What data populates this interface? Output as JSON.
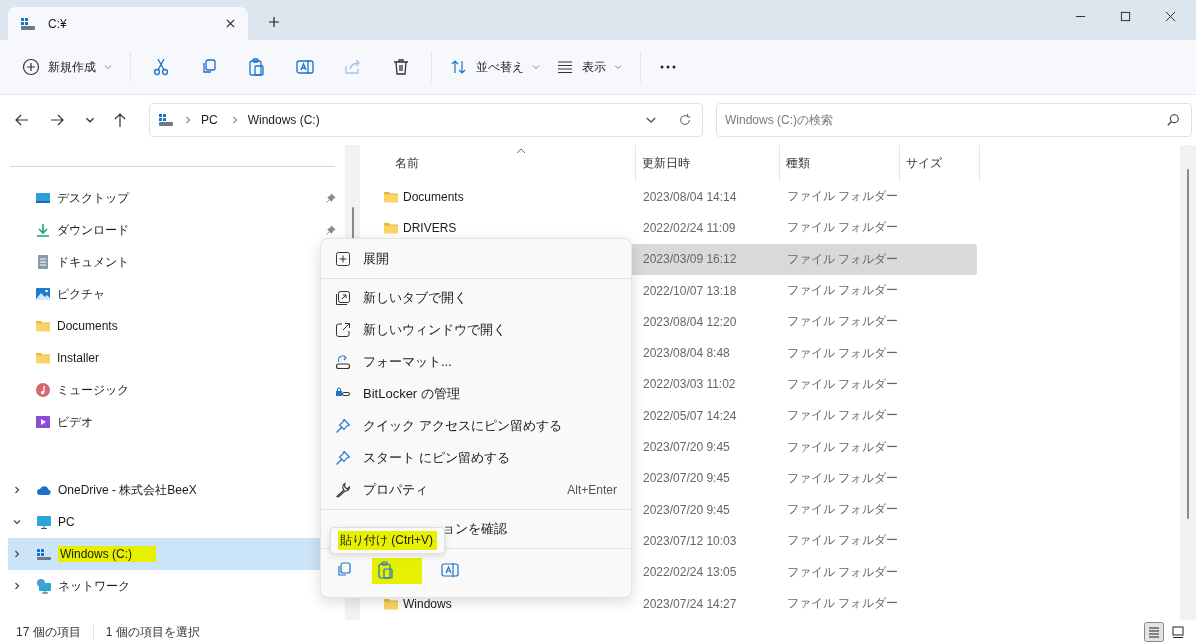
{
  "window": {
    "title": "C:¥"
  },
  "toolbar": {
    "new_label": "新規作成",
    "actions": [
      {
        "kind": "cut",
        "disabled": false
      },
      {
        "kind": "copy",
        "disabled": false
      },
      {
        "kind": "paste",
        "disabled": false
      },
      {
        "kind": "rename",
        "disabled": false
      },
      {
        "kind": "share",
        "disabled": true
      },
      {
        "kind": "delete",
        "disabled": false
      }
    ],
    "sort_label": "並べ替え",
    "view_label": "表示"
  },
  "address": {
    "crumbs": [
      "PC",
      "Windows (C:)"
    ]
  },
  "search": {
    "placeholder": "Windows (C:)の検索"
  },
  "sidebar": {
    "quick_access": [
      {
        "label": "デスクトップ",
        "kind": "desktop",
        "pinned": true
      },
      {
        "label": "ダウンロード",
        "kind": "download",
        "pinned": true
      },
      {
        "label": "ドキュメント",
        "kind": "document"
      },
      {
        "label": "ピクチャ",
        "kind": "picture"
      },
      {
        "label": "Documents",
        "kind": "folder"
      },
      {
        "label": "Installer",
        "kind": "folder"
      },
      {
        "label": "ミュージック",
        "kind": "music"
      },
      {
        "label": "ビデオ",
        "kind": "video"
      }
    ],
    "tree": [
      {
        "label": "OneDrive - 株式会社BeeX",
        "kind": "cloud",
        "expanded": false,
        "selected": false
      },
      {
        "label": "PC",
        "kind": "pc",
        "expanded": true,
        "selected": false,
        "children": [
          {
            "label": "Windows (C:)",
            "kind": "drive",
            "expanded": false,
            "selected": true,
            "highlighted": true
          }
        ]
      },
      {
        "label": "ネットワーク",
        "kind": "network",
        "expanded": false,
        "selected": false
      }
    ]
  },
  "file_list": {
    "columns": [
      "名前",
      "更新日時",
      "種類",
      "サイズ"
    ],
    "rows": [
      {
        "name": "Documents",
        "modified": "2023/08/04 14:14",
        "type": "ファイル フォルダー",
        "selected": false
      },
      {
        "name": "DRIVERS",
        "modified": "2022/02/24 11:09",
        "type": "ファイル フォルダー",
        "selected": false
      },
      {
        "modified": "2023/03/09 16:12",
        "type": "ファイル フォルダー",
        "selected": true
      },
      {
        "modified": "2022/10/07 13:18",
        "type": "ファイル フォルダー",
        "selected": false
      },
      {
        "modified": "2023/08/04 12:20",
        "type": "ファイル フォルダー",
        "selected": false
      },
      {
        "modified": "2023/08/04 8:48",
        "type": "ファイル フォルダー",
        "selected": false
      },
      {
        "modified": "2022/03/03 11:02",
        "type": "ファイル フォルダー",
        "selected": false
      },
      {
        "modified": "2022/05/07 14:24",
        "type": "ファイル フォルダー",
        "selected": false
      },
      {
        "modified": "2023/07/20 9:45",
        "type": "ファイル フォルダー",
        "selected": false
      },
      {
        "modified": "2023/07/20 9:45",
        "type": "ファイル フォルダー",
        "selected": false
      },
      {
        "modified": "2023/07/20 9:45",
        "type": "ファイル フォルダー",
        "selected": false
      },
      {
        "modified": "2023/07/12 10:03",
        "type": "ファイル フォルダー",
        "selected": false
      },
      {
        "modified": "2022/02/24 13:05",
        "type": "ファイル フォルダー",
        "selected": false
      },
      {
        "name": "Windows",
        "modified": "2023/07/24 14:27",
        "type": "ファイル フォルダー",
        "selected": false
      }
    ]
  },
  "context_menu": {
    "items": [
      {
        "kind": "expand",
        "label": "展開"
      },
      {
        "kind": "divider"
      },
      {
        "kind": "open-tab",
        "label": "新しいタブで開く"
      },
      {
        "kind": "open-window",
        "label": "新しいウィンドウで開く"
      },
      {
        "kind": "format",
        "label": "フォーマット..."
      },
      {
        "kind": "bitlocker",
        "label": "BitLocker の管理"
      },
      {
        "kind": "pin",
        "label": "クイック アクセスにピン留めする"
      },
      {
        "kind": "pin",
        "label": "スタート にピン留めする"
      },
      {
        "kind": "properties",
        "label": "プロパティ",
        "shortcut": "Alt+Enter"
      },
      {
        "kind": "divider"
      },
      {
        "kind": "covered",
        "label": "ョンを確認"
      },
      {
        "kind": "divider"
      }
    ],
    "actions": [
      {
        "kind": "copy",
        "highlighted": false
      },
      {
        "kind": "paste",
        "highlighted": true
      },
      {
        "kind": "rename",
        "highlighted": false
      }
    ],
    "tooltip": {
      "text": "貼り付け (Ctrl+V)",
      "highlighted": true
    }
  },
  "status_bar": {
    "count": "17 個の項目",
    "selection": "1 個の項目を選択",
    "views": [
      {
        "kind": "details",
        "selected": true
      },
      {
        "kind": "tiles",
        "selected": false
      }
    ]
  }
}
